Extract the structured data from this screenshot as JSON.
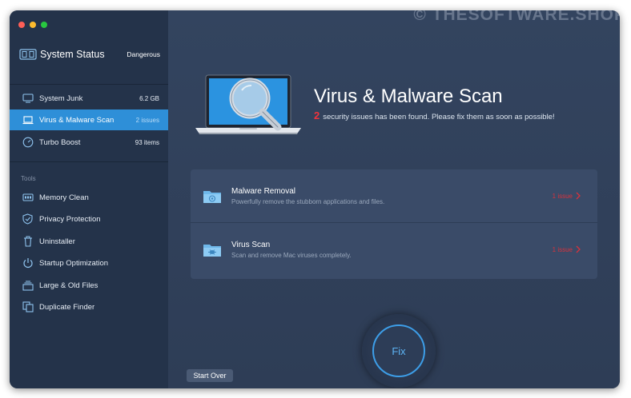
{
  "watermark": "© THESOFTWARE.SHOP",
  "window": {
    "controls": [
      "close",
      "minimize",
      "zoom"
    ]
  },
  "system_status": {
    "title": "System Status",
    "value": "Dangerous"
  },
  "sidebar": {
    "scan_items": [
      {
        "label": "System Junk",
        "value": "6.2 GB",
        "icon": "monitor-icon"
      },
      {
        "label": "Virus & Malware Scan",
        "value": "2 issues",
        "icon": "laptop-icon",
        "active": true
      },
      {
        "label": "Turbo Boost",
        "value": "93 items",
        "icon": "speedometer-icon"
      }
    ],
    "tools_label": "Tools",
    "tools": [
      {
        "label": "Memory Clean",
        "icon": "memory-icon"
      },
      {
        "label": "Privacy Protection",
        "icon": "shield-icon"
      },
      {
        "label": "Uninstaller",
        "icon": "trash-icon"
      },
      {
        "label": "Startup Optimization",
        "icon": "power-icon"
      },
      {
        "label": "Large & Old Files",
        "icon": "files-icon"
      },
      {
        "label": "Duplicate Finder",
        "icon": "duplicate-icon"
      }
    ]
  },
  "main": {
    "title": "Virus & Malware Scan",
    "issue_count": "2",
    "subtitle": "security issues has been found. Please fix them as soon as possible!",
    "rows": [
      {
        "title": "Malware Removal",
        "desc": "Powerfully remove the stubborn applications and files.",
        "issue": "1 issue",
        "icon": "malware-folder-icon"
      },
      {
        "title": "Virus Scan",
        "desc": "Scan and remove Mac viruses completely.",
        "issue": "1 issue",
        "icon": "virus-folder-icon"
      }
    ],
    "fix_label": "Fix",
    "start_over_label": "Start Over"
  },
  "colors": {
    "accent": "#2e8fd8",
    "danger": "#f2323c",
    "sidebar_bg": "#24334a",
    "main_bg": "#33445f"
  }
}
